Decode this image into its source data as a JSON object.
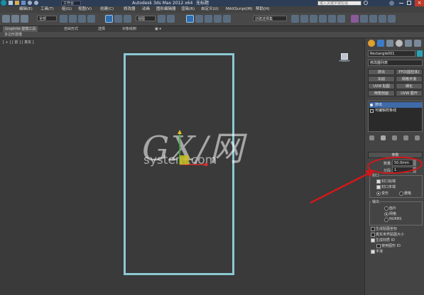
{
  "titlebar": {
    "app_title": "Autodesk 3ds Max  2012 x64",
    "file_name": "无标题",
    "search_placeholder": "键入关键字或短语",
    "workspace": "工作台"
  },
  "menubar": {
    "items": [
      "编辑(E)",
      "工具(T)",
      "组(G)",
      "视图(V)",
      "创建(C)",
      "修改器",
      "动画",
      "图形编辑器",
      "渲染(R)",
      "自定义(U)",
      "MAXScript(M)",
      "帮助(H)"
    ]
  },
  "toolbar": {
    "selection_filter": "全部",
    "reference_coord": "视图",
    "named_selection": "创建选择集"
  },
  "ribbon": {
    "tabs": [
      "Graphite 建模工具",
      "自由形式",
      "选择",
      "对象绘制"
    ],
    "sub_label": "多边形建模"
  },
  "viewport": {
    "label": "[ + ] [ 前 ] [ 真实 ]"
  },
  "watermark": {
    "main": "GX/网",
    "sub": "system.com"
  },
  "panel": {
    "object_name": "Rectangle001",
    "modifier_list": "修改器列表",
    "buttons": [
      "挤出",
      "FFD(圆柱体)",
      "车削",
      "网格平滑",
      "UVW 贴图",
      "细化",
      "倒角剖面",
      "UVW 展开"
    ],
    "stack": [
      "挤出",
      "可编辑样条线"
    ],
    "rollout_title": "参数",
    "amount_label": "数量:",
    "amount_value": "50.0mm",
    "segments_label": "分段:",
    "segments_value": "1",
    "capping_label": "封口",
    "cap_start": "封口始端",
    "cap_end": "封口末端",
    "morph": "变形",
    "grid": "栅格",
    "output_label": "输出",
    "out_patch": "面片",
    "out_mesh": "网格",
    "out_nurbs": "NURBS",
    "gen_mapping": "生成贴图坐标",
    "real_world": "真实世界贴图大小",
    "gen_mat_ids": "生成材质 ID",
    "use_shape_ids": "使用图形 ID",
    "smooth": "平滑"
  },
  "colors": {
    "rectangle": "#8cc8d2",
    "annotation": "#d0181c",
    "titlebar": "#2d3d55"
  }
}
